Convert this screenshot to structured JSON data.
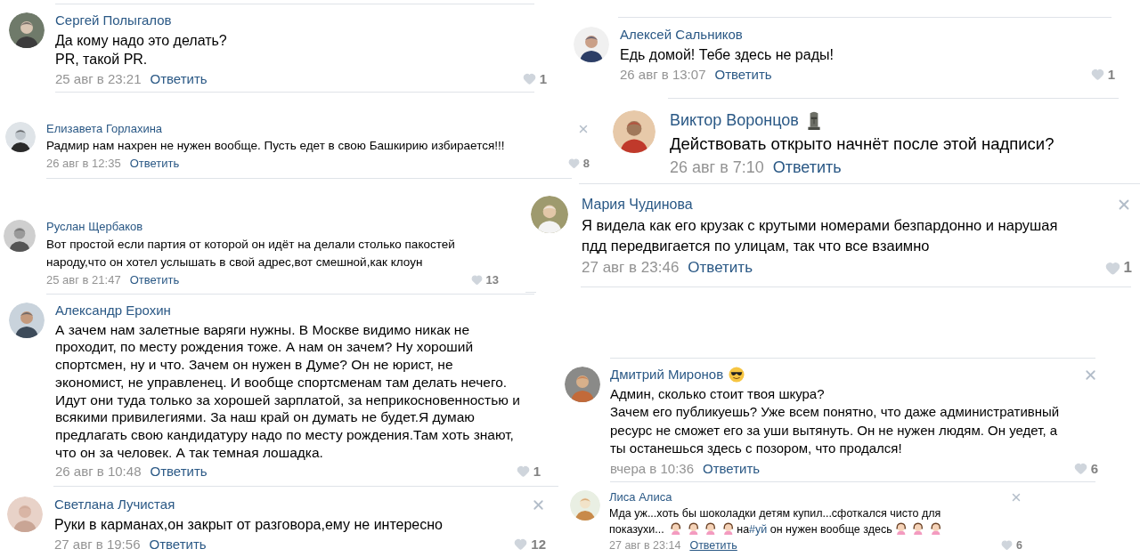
{
  "comments": [
    {
      "author": "Сергей Полыгалов",
      "closable": false,
      "text": "Да кому надо это делать?\nPR, такой PR.",
      "date": "25 авг в 23:21",
      "reply": "Ответить",
      "reply_underlined": false,
      "likes": "1"
    },
    {
      "author": "Елизавета Горлахина",
      "closable": true,
      "text": "Радмир нам нахрен не нужен вообще. Пусть едет в свою Башкирию избирается!!!",
      "date": "26 авг в 12:35",
      "reply": "Ответить",
      "reply_underlined": false,
      "likes": "8"
    },
    {
      "author": "Руслан Щербаков",
      "closable": false,
      "text": "Вот простой если партия от которой он идёт на делали столько пакостей\nнароду,что он хотел услышать в свой адрес,вот смешной,как клоун",
      "date": "25 авг в 21:47",
      "reply": "Ответить",
      "reply_underlined": false,
      "likes": "13"
    },
    {
      "author": "Александр Ерохин",
      "closable": false,
      "text": "А зачем нам залетные варяги нужны. В Москве видимо никак не\nпроходит, по месту рождения тоже. А нам он зачем? Ну хороший\nспортсмен, ну и что. Зачем он нужен в Думе? Он не юрист, не\nэкономист, не управленец. И вообще спортсменам там делать нечего.\nИдут они туда только за хорошей зарплатой, за неприкосновенностью и\nвсякими привилегиями. За наш край он думать не будет.Я думаю\nпредлагать свою кандидатуру надо по месту рождения.Там хоть знают,\nчто он за человек. А так темная лошадка.",
      "date": "26 авг в 10:48",
      "reply": "Ответить",
      "reply_underlined": false,
      "likes": "1"
    },
    {
      "author": "Светлана Лучистая",
      "closable": true,
      "text": "Руки в карманах,он закрыт от разговора,ему не интересно",
      "date": "27 авг в 19:56",
      "reply": "Ответить",
      "reply_underlined": false,
      "likes": "12"
    },
    {
      "author": "Алексей Сальников",
      "closable": false,
      "text": "Едь домой! Тебе здесь не рады!",
      "date": "26 авг в 13:07",
      "reply": "Ответить",
      "reply_underlined": false,
      "likes": "1"
    },
    {
      "author": "Виктор Воронцов",
      "badge": {
        "kind": "statue"
      },
      "closable": false,
      "text": "Действовать открыто начнёт после этой надписи?",
      "date": "26 авг в 7:10",
      "reply": "Ответить",
      "reply_underlined": false
    },
    {
      "author": "Мария Чудинова",
      "closable": true,
      "text": "Я видела как его крузак с крутыми номерами безпардонно и нарушая\nпдд передвигается по улицам, так что все взаимно",
      "date": "27 авг в 23:46",
      "reply": "Ответить",
      "reply_underlined": false,
      "likes": "1"
    },
    {
      "author": "Дмитрий Миронов",
      "badge": {
        "kind": "smile"
      },
      "closable": true,
      "text": "Админ, сколько стоит твоя шкура?\nЗачем его публикуешь? Уже всем понятно, что даже административный\nресурс не сможет его за уши вытянуть. Он не нужен людям. Он уедет, а\nты останешься здесь с позором, что продался!",
      "date": "вчера в 10:36",
      "reply": "Ответить",
      "reply_underlined": false,
      "likes": "6"
    },
    {
      "author": "Лиса Алиса",
      "closable": true,
      "parts": [
        {
          "kind": "text",
          "text": "Мда уж...хоть бы шоколадки детям купил...сфоткался чисто для\nпоказухи... "
        },
        {
          "kind": "emoji"
        },
        {
          "kind": "emoji"
        },
        {
          "kind": "emoji"
        },
        {
          "kind": "emoji"
        },
        {
          "kind": "text",
          "text": "на"
        },
        {
          "kind": "hashtag",
          "text": "#уй"
        },
        {
          "kind": "text",
          "text": " он нужен вообще здесь"
        },
        {
          "kind": "emoji"
        },
        {
          "kind": "emoji"
        },
        {
          "kind": "emoji"
        }
      ],
      "date": "27 авг в 23:14",
      "reply": "Ответить",
      "reply_underlined": true,
      "likes": "6"
    }
  ]
}
